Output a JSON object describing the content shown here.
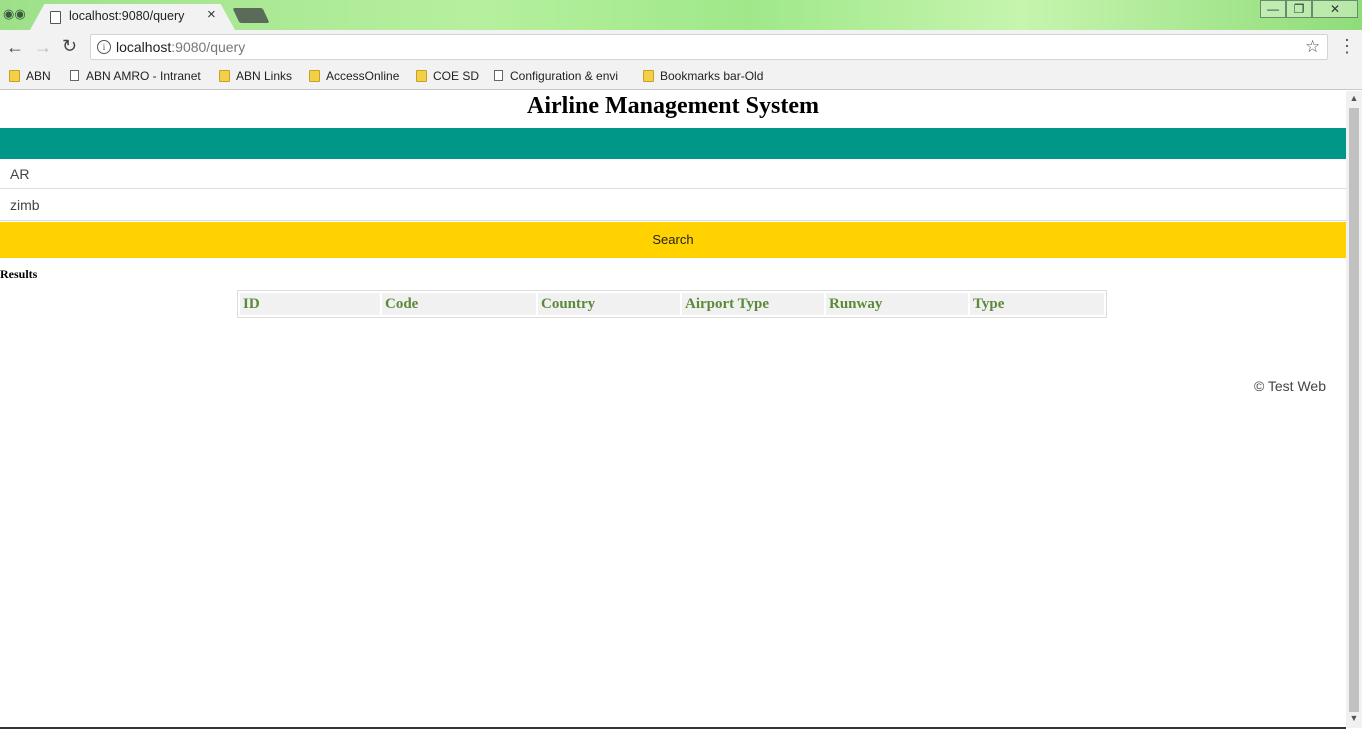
{
  "browser": {
    "tab_title": "localhost:9080/query",
    "tab_close": "×",
    "url_host": "localhost",
    "url_rest": ":9080/query",
    "window_buttons": {
      "minimize": "—",
      "maximize": "❐",
      "close": "✕"
    },
    "nav": {
      "back": "←",
      "forward": "→",
      "reload": "↻",
      "star": "☆",
      "menu": "⋮",
      "info": "i"
    },
    "bookmarks": [
      {
        "label": "ABN",
        "icon": "folder-icon"
      },
      {
        "label": "ABN AMRO - Intranet",
        "icon": "page-icon"
      },
      {
        "label": "ABN Links",
        "icon": "folder-icon"
      },
      {
        "label": "AccessOnline",
        "icon": "folder-icon"
      },
      {
        "label": "COE SD",
        "icon": "folder-icon"
      },
      {
        "label": "Configuration & envi",
        "icon": "page-icon"
      },
      {
        "label": "Bookmarks bar-Old",
        "icon": "folder-icon"
      }
    ]
  },
  "page": {
    "title": "Airline Management System",
    "form": {
      "code_value": "AR",
      "country_value": "zimb",
      "search_label": "Search"
    },
    "results_label": "Results",
    "table": {
      "columns": [
        "ID",
        "Code",
        "Country",
        "Airport Type",
        "Runway",
        "Type"
      ],
      "rows": []
    },
    "footer": "© Test Web"
  },
  "colors": {
    "teal_bar": "#009688",
    "search_button": "#ffd200",
    "header_text": "#5a8a3a"
  }
}
